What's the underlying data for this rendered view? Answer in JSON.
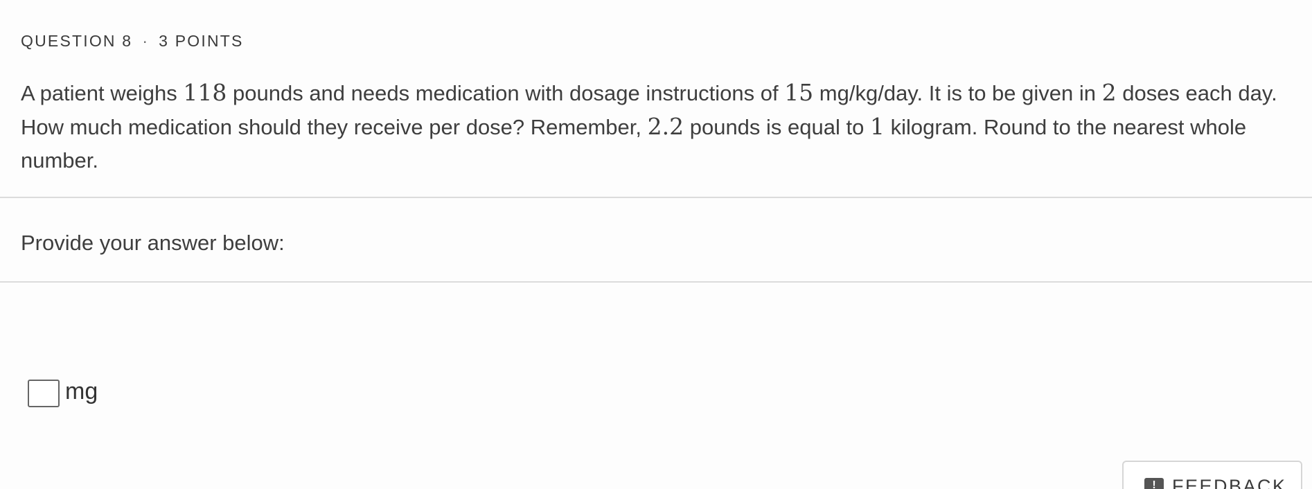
{
  "question": {
    "number_label": "QUESTION 8",
    "separator": "·",
    "points_label": "3 POINTS",
    "text_parts": [
      {
        "t": "A patient weighs ",
        "math": false
      },
      {
        "t": "118",
        "math": true
      },
      {
        "t": " pounds and needs medication with dosage instructions of ",
        "math": false
      },
      {
        "t": "15",
        "math": true
      },
      {
        "t": " mg/kg/day. It is to be given in ",
        "math": false
      },
      {
        "t": "2",
        "math": true
      },
      {
        "t": " doses each day. How much medication should they receive per dose? Remember, ",
        "math": false
      },
      {
        "t": "2.2",
        "math": true
      },
      {
        "t": " pounds is equal to ",
        "math": false
      },
      {
        "t": "1",
        "math": true
      },
      {
        "t": " kilogram. Round to the nearest whole number.",
        "math": false
      }
    ]
  },
  "answer": {
    "prompt": "Provide your answer below:",
    "input_value": "",
    "unit": "mg"
  },
  "feedback": {
    "icon": "exclamation-icon",
    "icon_glyph": "!",
    "label": "FEEDBACK"
  }
}
